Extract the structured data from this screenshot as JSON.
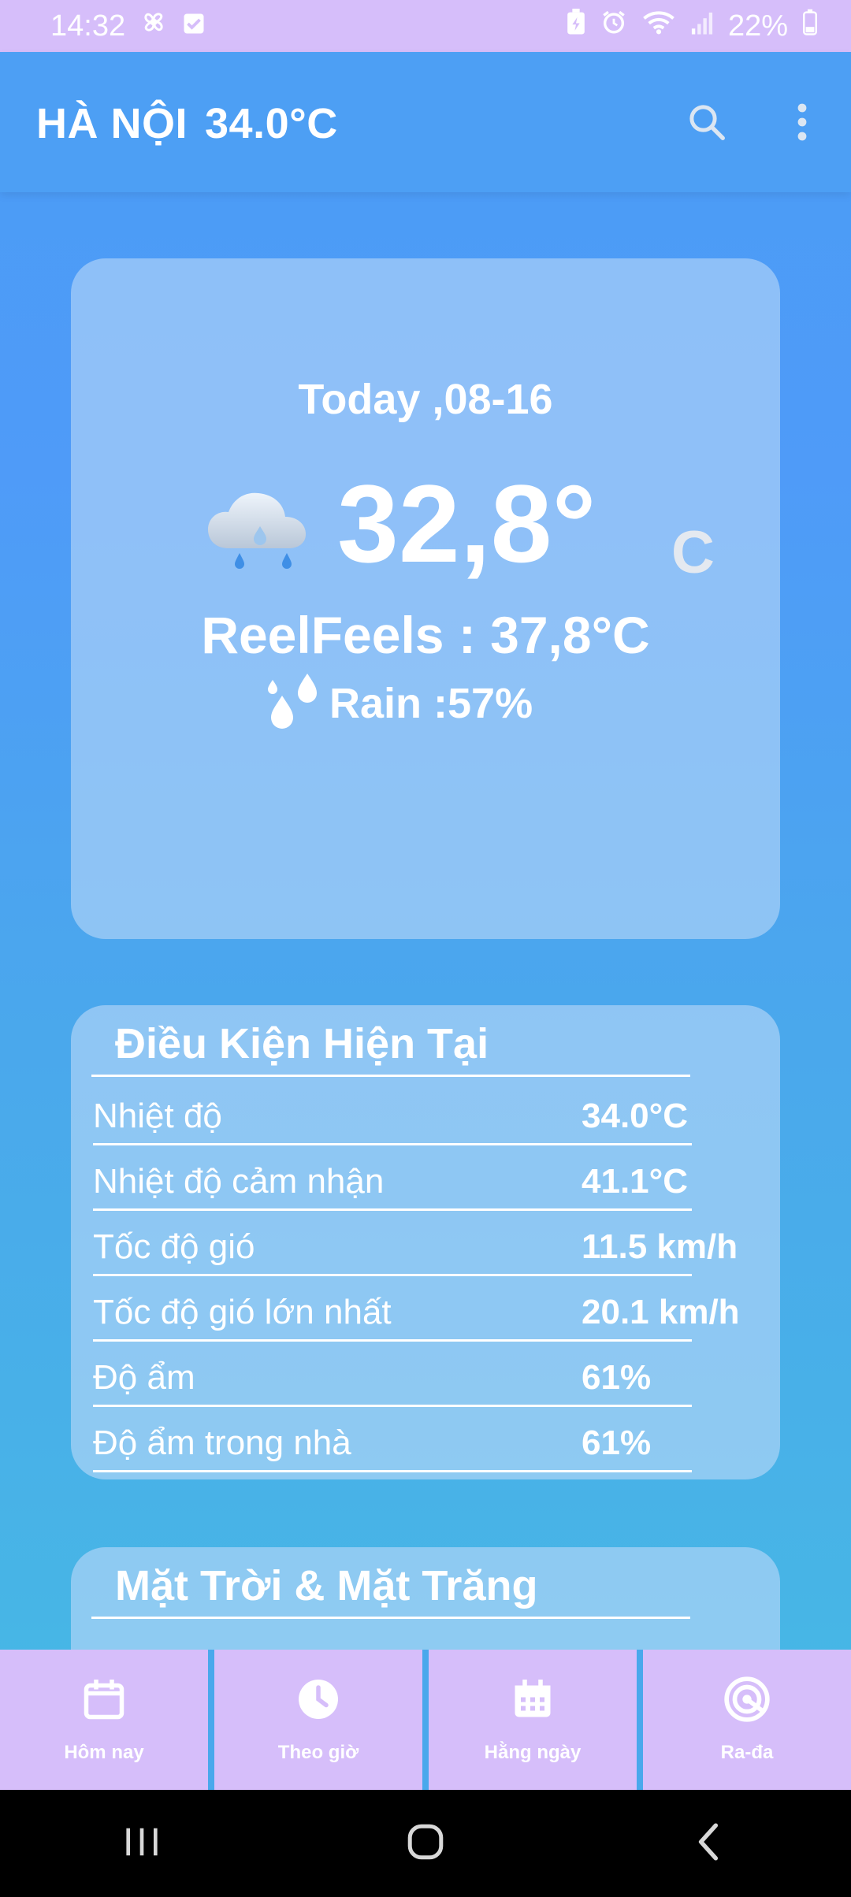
{
  "status_bar": {
    "time": "14:32",
    "battery": "22%"
  },
  "app_bar": {
    "city": "HÀ NỘI",
    "temperature": "34.0°C"
  },
  "today": {
    "date": "Today ,08-16",
    "temperature": "32,8°",
    "unit": "C",
    "real_feel": "ReelFeels : 37,8°C",
    "rain": "Rain :57%"
  },
  "conditions": {
    "title": "Điều Kiện Hiện Tại",
    "rows": [
      {
        "label": "Nhiệt độ",
        "value": "34.0°C"
      },
      {
        "label": "Nhiệt độ cảm nhận",
        "value": "41.1°C"
      },
      {
        "label": "Tốc độ gió",
        "value": "11.5 km/h"
      },
      {
        "label": "Tốc độ gió lớn nhất",
        "value": "20.1 km/h"
      },
      {
        "label": "Độ ẩm",
        "value": "61%"
      },
      {
        "label": "Độ ẩm trong nhà",
        "value": "61%"
      }
    ]
  },
  "sun_moon": {
    "title": "Mặt Trời & Mặt Trăng"
  },
  "bottom_nav": [
    {
      "label": "Hôm nay",
      "icon": "calendar-icon"
    },
    {
      "label": "Theo giờ",
      "icon": "clock-icon"
    },
    {
      "label": "Hằng ngày",
      "icon": "calendar-grid-icon"
    },
    {
      "label": "Ra-đa",
      "icon": "radar-icon"
    }
  ],
  "colors": {
    "accent": "#d6befa",
    "background": "#4a9cf5",
    "card": "#bad8f8"
  }
}
